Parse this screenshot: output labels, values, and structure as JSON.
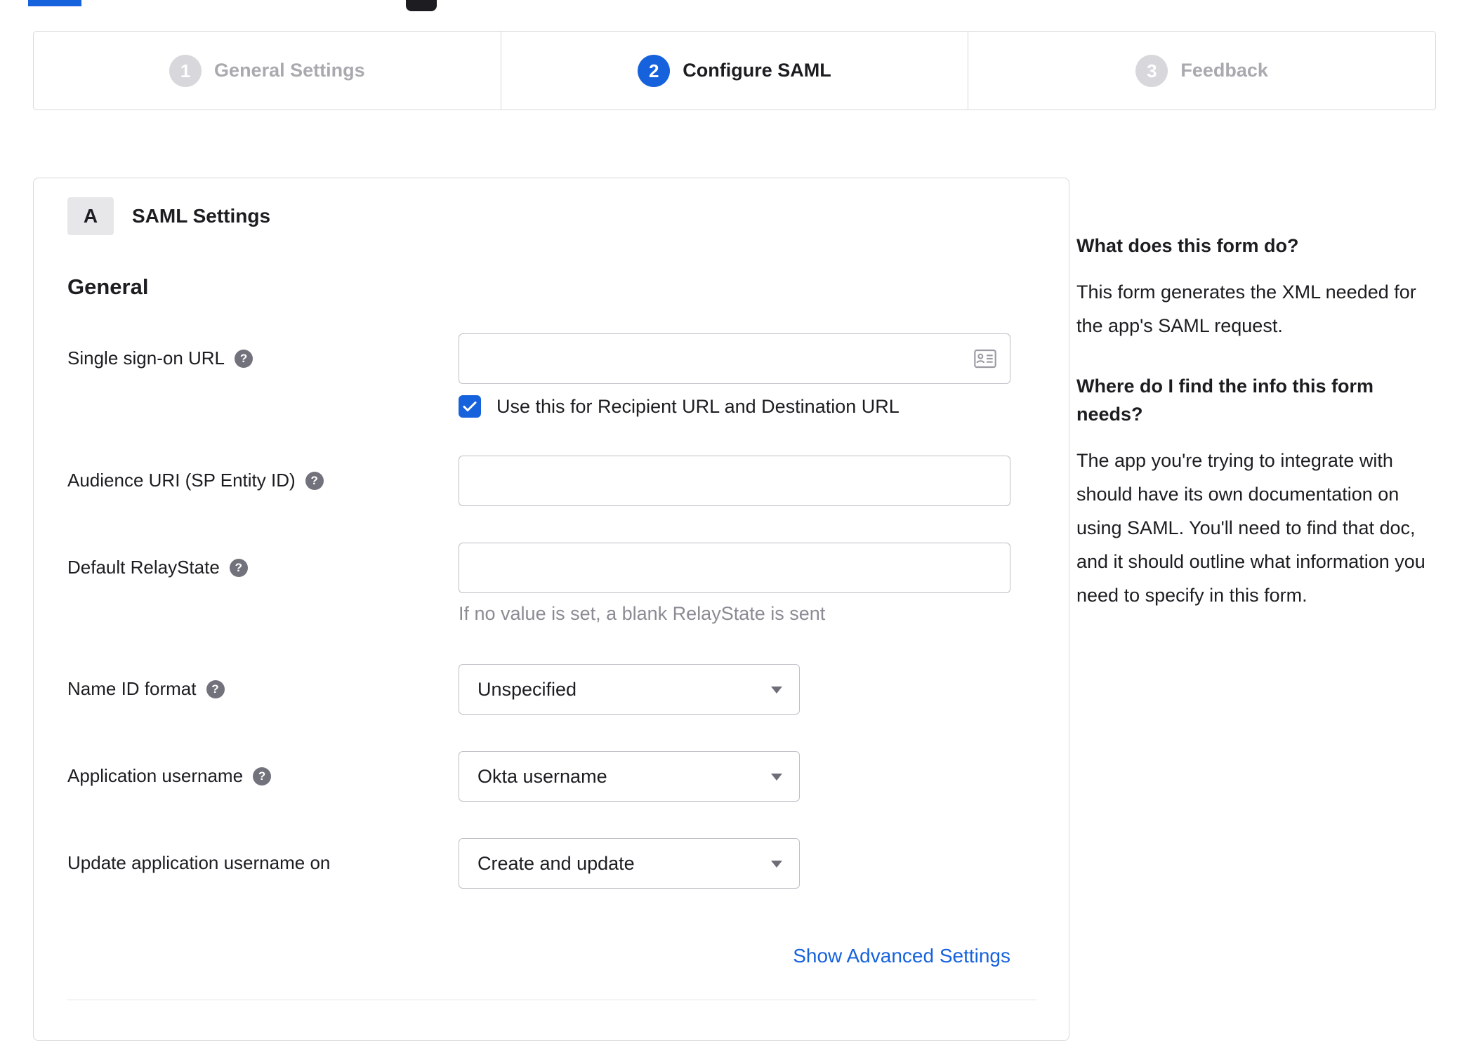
{
  "stepper": {
    "steps": [
      {
        "number": "1",
        "label": "General Settings"
      },
      {
        "number": "2",
        "label": "Configure SAML"
      },
      {
        "number": "3",
        "label": "Feedback"
      }
    ]
  },
  "panel": {
    "badge": "A",
    "title": "SAML Settings",
    "general_heading": "General",
    "fields": {
      "sso_url": {
        "label": "Single sign-on URL",
        "value": ""
      },
      "sso_checkbox": {
        "label": "Use this for Recipient URL and Destination URL",
        "checked": true
      },
      "audience_uri": {
        "label": "Audience URI (SP Entity ID)",
        "value": ""
      },
      "default_relaystate": {
        "label": "Default RelayState",
        "value": "",
        "hint": "If no value is set, a blank RelayState is sent"
      },
      "name_id_format": {
        "label": "Name ID format",
        "value": "Unspecified"
      },
      "application_username": {
        "label": "Application username",
        "value": "Okta username"
      },
      "update_app_username": {
        "label": "Update application username on",
        "value": "Create and update"
      }
    },
    "advanced_link": "Show Advanced Settings"
  },
  "help": {
    "q1": "What does this form do?",
    "a1": "This form generates the XML needed for the app's SAML request.",
    "q2": "Where do I find the info this form needs?",
    "a2": "The app you're trying to integrate with should have its own documentation on using SAML. You'll need to find that doc, and it should outline what information you need to specify in this form."
  },
  "colors": {
    "accent": "#1662dd",
    "inactive_step": "#d7d7dc",
    "border": "#d9d9dd",
    "hint_text": "#8b8b94"
  }
}
